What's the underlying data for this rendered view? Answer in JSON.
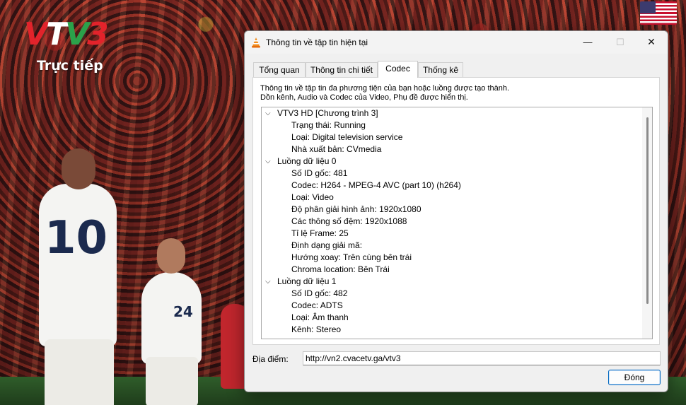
{
  "overlay": {
    "channel_logo": "VTV3",
    "live_label": "Trực tiếp",
    "flag_icon": "us-flag-icon",
    "jersey_numbers": [
      "10",
      "24"
    ]
  },
  "dialog": {
    "title": "Thông tin về tập tin hiện tại",
    "window_controls": {
      "minimize": "—",
      "maximize": "☐",
      "close": "✕"
    },
    "tabs": [
      {
        "label": "Tổng quan",
        "active": false
      },
      {
        "label": "Thông tin chi tiết",
        "active": false
      },
      {
        "label": "Codec",
        "active": true
      },
      {
        "label": "Thống kê",
        "active": false
      }
    ],
    "description_line1": "Thông tin về tập tin đa phương tiện của bạn hoặc luồng được tạo thành.",
    "description_line2": "Dồn kênh, Audio và Codec của Video, Phụ đề được hiển thị.",
    "tree": [
      {
        "label": "VTV3 HD [Chương trình 3]",
        "expanded": true,
        "items": [
          "Trạng thái: Running",
          "Loại: Digital television service",
          "Nhà xuất bản: CVmedia"
        ]
      },
      {
        "label": "Luồng dữ liệu 0",
        "expanded": true,
        "items": [
          "Số ID gốc: 481",
          "Codec: H264 - MPEG-4 AVC (part 10) (h264)",
          "Loại: Video",
          "Độ phân giải hình ảnh: 1920x1080",
          "Các thông số đệm: 1920x1088",
          "Tỉ lệ Frame: 25",
          "Định dạng giải mã:",
          "Hướng xoay: Trên cùng bên trái",
          "Chroma location: Bên Trái"
        ]
      },
      {
        "label": "Luồng dữ liệu 1",
        "expanded": true,
        "items": [
          "Số ID gốc: 482",
          "Codec: ADTS",
          "Loại: Âm thanh",
          "Kênh: Stereo"
        ]
      }
    ],
    "location_label": "Địa điểm:",
    "location_value": "http://vn2.cvacetv.ga/vtv3",
    "close_button": "Đóng"
  },
  "colors": {
    "vtv_red": "#e2232b",
    "vtv_green": "#2ba14a",
    "accent_blue": "#0067c0"
  }
}
